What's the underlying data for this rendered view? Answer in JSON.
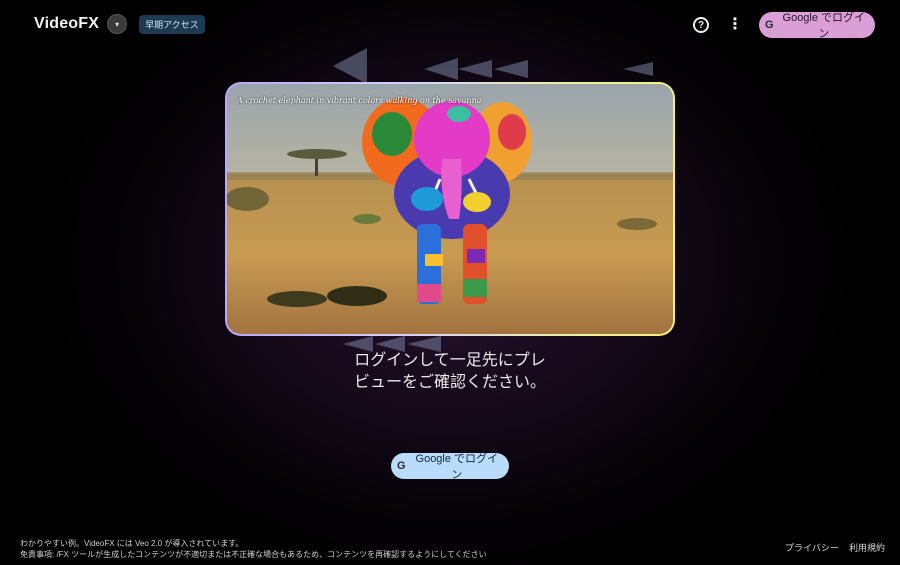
{
  "header": {
    "brand": "VideoFX",
    "toggle_glyph": "▾",
    "early_access": "早期アクセス",
    "help_glyph": "?",
    "more_glyph": "⋮",
    "login_label": "Google でログイン",
    "google_glyph": "G"
  },
  "hero": {
    "caption": "A crochet elephant in vibrant colors walking on the savanna"
  },
  "main": {
    "heading_line1": "ログインして一足先にプレ",
    "heading_line2": "ビューをご確認ください。",
    "login_label": "Google でログイン",
    "google_glyph": "G"
  },
  "footer": {
    "note_line1": "わかりやすい例。VideoFX には Veo 2.0 が導入されています。",
    "note_line2": "免責事項: /FX ツールが生成したコンテンツが不適切または不正確な場合もあるため、コンテンツを再確認するようにしてください",
    "privacy": "プライバシー",
    "terms": "利用規約"
  },
  "colors": {
    "login_top_bg": "#d99fd6",
    "login_main_bg": "#b9dcfb",
    "badge_bg": "#1d3a52"
  }
}
